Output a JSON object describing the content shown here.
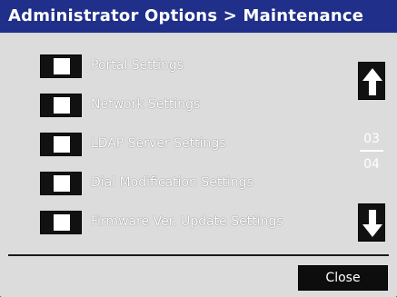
{
  "window": {
    "title": "Administrator Options > Maintenance"
  },
  "menu": {
    "items": [
      {
        "label": "Portal Settings"
      },
      {
        "label": "Network Settings"
      },
      {
        "label": "LDAP Server Settings"
      },
      {
        "label": "Dial Modification Settings"
      },
      {
        "label": "Firmware Ver. Update Settings"
      }
    ]
  },
  "pagination": {
    "current": "03",
    "total": "04"
  },
  "buttons": {
    "close_label": "Close"
  },
  "icons": {
    "scroll_up": "arrow-up-icon",
    "scroll_down": "arrow-down-icon"
  },
  "colors": {
    "titlebar": "#1f2f8a",
    "background": "#dcdcdc",
    "button": "#111111"
  }
}
